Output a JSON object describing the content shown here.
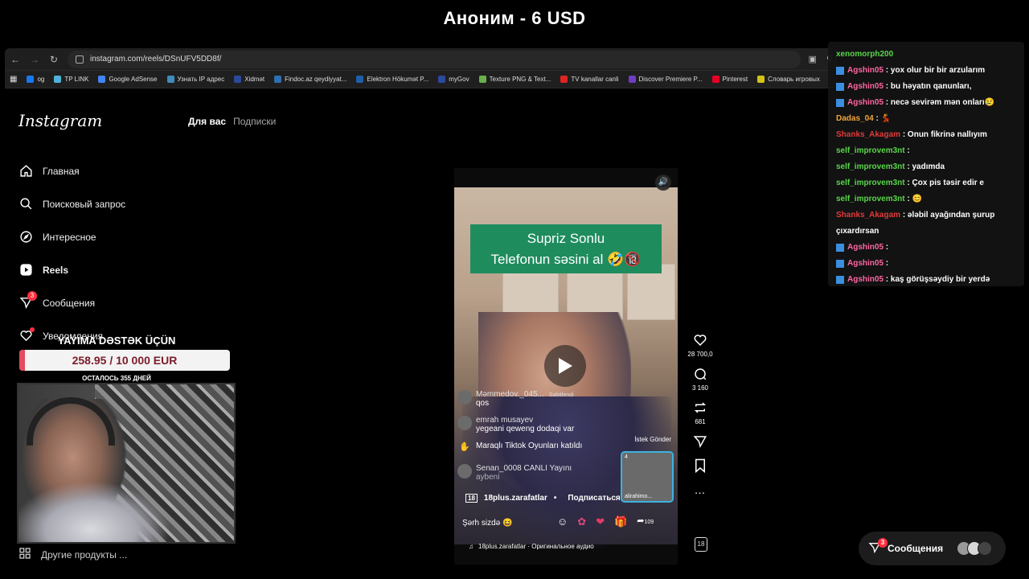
{
  "stream": {
    "title": "Аноним - 6 USD"
  },
  "browser": {
    "url": "instagram.com/reels/DSnUFV5DD8f/",
    "bookmarks": [
      {
        "label": "og",
        "color": "#1877f2"
      },
      {
        "label": "TP LINK",
        "color": "#4fb3d9"
      },
      {
        "label": "Google AdSense",
        "color": "#4285f4"
      },
      {
        "label": "Узнать IP адрес",
        "color": "#3c8dbc"
      },
      {
        "label": "Xidmət",
        "color": "#2a4b9b"
      },
      {
        "label": "Findoc.az qeydiyyat...",
        "color": "#2f6fb3"
      },
      {
        "label": "Elektron Hökumət P...",
        "color": "#1d5fa8"
      },
      {
        "label": "myGov",
        "color": "#2d4aa0"
      },
      {
        "label": "Texture PNG & Text...",
        "color": "#6ab04c"
      },
      {
        "label": "TV kanallar canli",
        "color": "#e02424"
      },
      {
        "label": "Discover Premiere P...",
        "color": "#6f3cc3"
      },
      {
        "label": "Pinterest",
        "color": "#e60023"
      },
      {
        "label": "Словарь игровых",
        "color": "#d4c21a"
      }
    ]
  },
  "instagram": {
    "logo": "Instagram",
    "tabs": {
      "for_you": "Для вас",
      "following": "Подписки"
    },
    "nav": [
      {
        "label": "Главная",
        "icon": "home-icon"
      },
      {
        "label": "Поисковый запрос",
        "icon": "search-icon"
      },
      {
        "label": "Интересное",
        "icon": "compass-icon"
      },
      {
        "label": "Reels",
        "icon": "reels-icon"
      },
      {
        "label": "Сообщения",
        "icon": "messages-icon",
        "badge": "3"
      },
      {
        "label": "Уведомления",
        "icon": "heart-icon"
      }
    ],
    "more_products": "Другие продукты ..."
  },
  "reel": {
    "caption_line1": "Supriz Sonlu",
    "caption_line2": "Telefonun səsini al 🤣🔞",
    "comments": [
      {
        "user": "Məmmedov._045...",
        "text": "qos",
        "pinned": "Sabitlendi"
      },
      {
        "user": "emrah musayev",
        "text": "yegeani qeweng dodaqi var"
      },
      {
        "user": "",
        "text": "Maraqlı Tiktok Oyunları katıldı"
      },
      {
        "user": "Senan_0008 CANLI Yayını",
        "text": "aybeni"
      }
    ],
    "send_gift": "İstek Gönder",
    "live_thumb_count": "4",
    "live_thumb_name": "alirahimo...",
    "author": "18plus.zarafatlar",
    "follow": "Подписаться",
    "comment_placeholder": "Şərh sizdə 😆",
    "gift_count": "109",
    "audio": "18plus.zarafatlar · Оригинальное аудио",
    "likes": "28 700,0",
    "comments_count": "3 160",
    "reposts": "681",
    "age_badge": "18"
  },
  "donation": {
    "title": "YAYIMA DƏSTƏK ÜÇÜN",
    "amount": "258.95 / 10 000 EUR",
    "progress_fraction": 0.026,
    "remaining": "ОСТАЛОСЬ 355 ДНЕЙ"
  },
  "chat": {
    "messages": [
      {
        "user": "xenomorph200",
        "color": "#59d64a",
        "text": ""
      },
      {
        "user": "Agshin05",
        "color": "#ff66a3",
        "text": ": yox olur bir bir arzularım",
        "icon": true
      },
      {
        "user": "Agshin05",
        "color": "#ff66a3",
        "text": ": bu həyatın qanunları,",
        "icon": true
      },
      {
        "user": "Agshin05",
        "color": "#ff66a3",
        "text": ": necə sevirəm mən onları😢",
        "icon": true
      },
      {
        "user": "Dadas_04",
        "color": "#f3a53a",
        "text": ": 💃"
      },
      {
        "user": "Shanks_Akagam",
        "color": "#e23a3a",
        "text": ": Onun fikrinə nallıyım"
      },
      {
        "user": "self_improvem3nt",
        "color": "#59d64a",
        "text": ":"
      },
      {
        "user": "self_improvem3nt",
        "color": "#59d64a",
        "text": ": yadımda"
      },
      {
        "user": "self_improvem3nt",
        "color": "#59d64a",
        "text": ": Çox pis təsir edir e"
      },
      {
        "user": "self_improvem3nt",
        "color": "#59d64a",
        "text": ": 😊"
      },
      {
        "user": "Shanks_Akagam",
        "color": "#e23a3a",
        "text": ": ələbil ayağından şurup çıxardırsan"
      },
      {
        "user": "Agshin05",
        "color": "#ff66a3",
        "text": ":",
        "icon": true
      },
      {
        "user": "Agshin05",
        "color": "#ff66a3",
        "text": ":",
        "icon": true
      },
      {
        "user": "Agshin05",
        "color": "#ff66a3",
        "text": ": kaş görüşsəydiy bir yerdə",
        "icon": true
      }
    ]
  },
  "messages_bubble": {
    "label": "Сообщения",
    "badge": "3"
  }
}
